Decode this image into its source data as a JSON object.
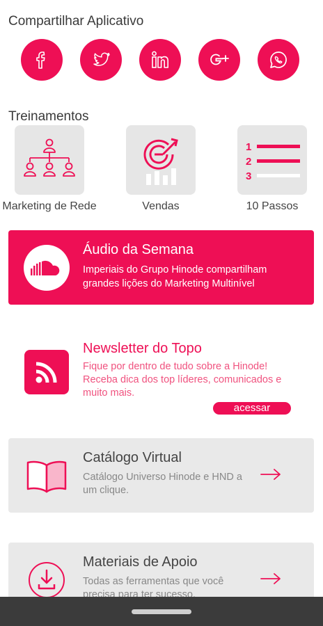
{
  "share": {
    "title": "Compartilhar Aplicativo",
    "buttons": [
      {
        "icon": "facebook-icon"
      },
      {
        "icon": "twitter-icon"
      },
      {
        "icon": "linkedin-icon"
      },
      {
        "icon": "google-plus-icon"
      },
      {
        "icon": "whatsapp-icon"
      }
    ]
  },
  "trainings": {
    "title": "Treinamentos",
    "items": [
      {
        "label": "Marketing de Rede",
        "icon": "org-chart-icon"
      },
      {
        "label": "Vendas",
        "icon": "sales-target-icon"
      },
      {
        "label": "10 Passos",
        "icon": "numbered-list-icon"
      }
    ]
  },
  "audio": {
    "title": "Áudio da Semana",
    "description": "Imperiais do Grupo Hinode compartilham grandes lições do Marketing Multinível",
    "icon": "soundcloud-icon"
  },
  "newsletter": {
    "title": "Newsletter do Topo",
    "description": "Fique por dentro de tudo sobre a Hinode! Receba dica dos top líderes, comunicados e muito mais.",
    "button": "acessar",
    "icon": "rss-icon"
  },
  "catalog": {
    "title": "Catálogo Virtual",
    "description": "Catálogo Universo Hinode e HND a um clique.",
    "icon": "open-book-icon"
  },
  "materials": {
    "title": "Materiais de Apoio",
    "description": "Todas as ferramentas que você precisa para ter sucesso.",
    "icon": "download-icon"
  },
  "colors": {
    "accent": "#ee0f55",
    "card_gray": "#e9e9e9",
    "tile_gray": "#e6e6e6",
    "nav_bar": "#3b3b3b"
  }
}
